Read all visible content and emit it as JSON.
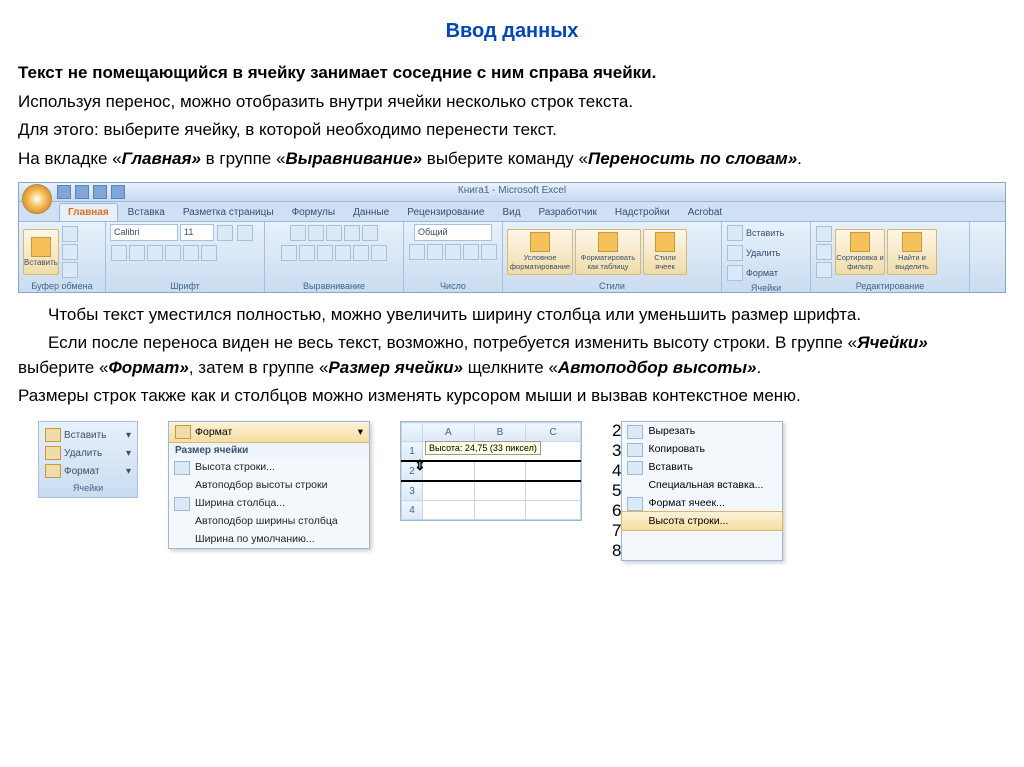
{
  "title": "Ввод данных",
  "para": {
    "p1": "Текст не помещающийся в ячейку занимает соседние с ним справа ячейки.",
    "p2": "Используя перенос, можно отобразить внутри ячейки несколько строк текста.",
    "p3": "Для этого: выберите ячейку, в которой необходимо перенести текст.",
    "p4a": "На вкладке «",
    "p4b": "Главная»",
    "p4c": " в группе «",
    "p4d": "Выравнивание»",
    "p4e": " выберите команду «",
    "p4f": "Переносить по словам»",
    "p4g": ".",
    "p5": "Чтобы текст уместился полностью, можно увеличить ширину столбца или уменьшить размер шрифта.",
    "p6a": "Если после переноса виден не весь текст, возможно, потребуется изменить высоту строки. В группе «",
    "p6b": "Ячейки»",
    "p6c": " выберите «",
    "p6d": "Формат»",
    "p6e": ", затем в группе «",
    "p6f": "Размер ячейки»",
    "p6g": " щелкните «",
    "p6h": "Автоподбор высоты»",
    "p6i": ".",
    "p7": "Размеры строк также как и столбцов можно изменять курсором мыши и вызвав контекстное меню."
  },
  "ribbon": {
    "window_title": "Книга1 - Microsoft Excel",
    "tabs": [
      "Главная",
      "Вставка",
      "Разметка страницы",
      "Формулы",
      "Данные",
      "Рецензирование",
      "Вид",
      "Разработчик",
      "Надстройки",
      "Acrobat"
    ],
    "groups": {
      "clipboard": {
        "label": "Буфер обмена",
        "paste": "Вставить"
      },
      "font": {
        "label": "Шрифт",
        "name": "Calibri",
        "size": "11"
      },
      "align": {
        "label": "Выравнивание"
      },
      "number": {
        "label": "Число",
        "format": "Общий"
      },
      "styles": {
        "label": "Стили",
        "cond": "Условное форматирование",
        "table": "Форматировать как таблицу",
        "cell": "Стили ячеек"
      },
      "cells": {
        "label": "Ячейки",
        "insert": "Вставить",
        "delete": "Удалить",
        "format": "Формат"
      },
      "editing": {
        "label": "Редактирование",
        "sort": "Сортировка и фильтр",
        "find": "Найти и выделить"
      }
    }
  },
  "cells_panel": {
    "insert": "Вставить",
    "delete": "Удалить",
    "format": "Формат",
    "label": "Ячейки"
  },
  "format_menu": {
    "header": "Формат",
    "section": "Размер ячейки",
    "items": [
      "Высота строки...",
      "Автоподбор высоты строки",
      "Ширина столбца...",
      "Автоподбор ширины столбца",
      "Ширина по умолчанию..."
    ]
  },
  "sheet": {
    "cols": [
      "A",
      "B",
      "C"
    ],
    "rows": [
      "1",
      "2",
      "3",
      "4"
    ],
    "tooltip": "Высота: 24,75 (33 пиксел)"
  },
  "context_menu": {
    "rows": [
      "2",
      "3",
      "4",
      "5",
      "6",
      "7",
      "8"
    ],
    "items": [
      "Вырезать",
      "Копировать",
      "Вставить",
      "Специальная вставка...",
      "Формат ячеек...",
      "Высота строки..."
    ]
  }
}
